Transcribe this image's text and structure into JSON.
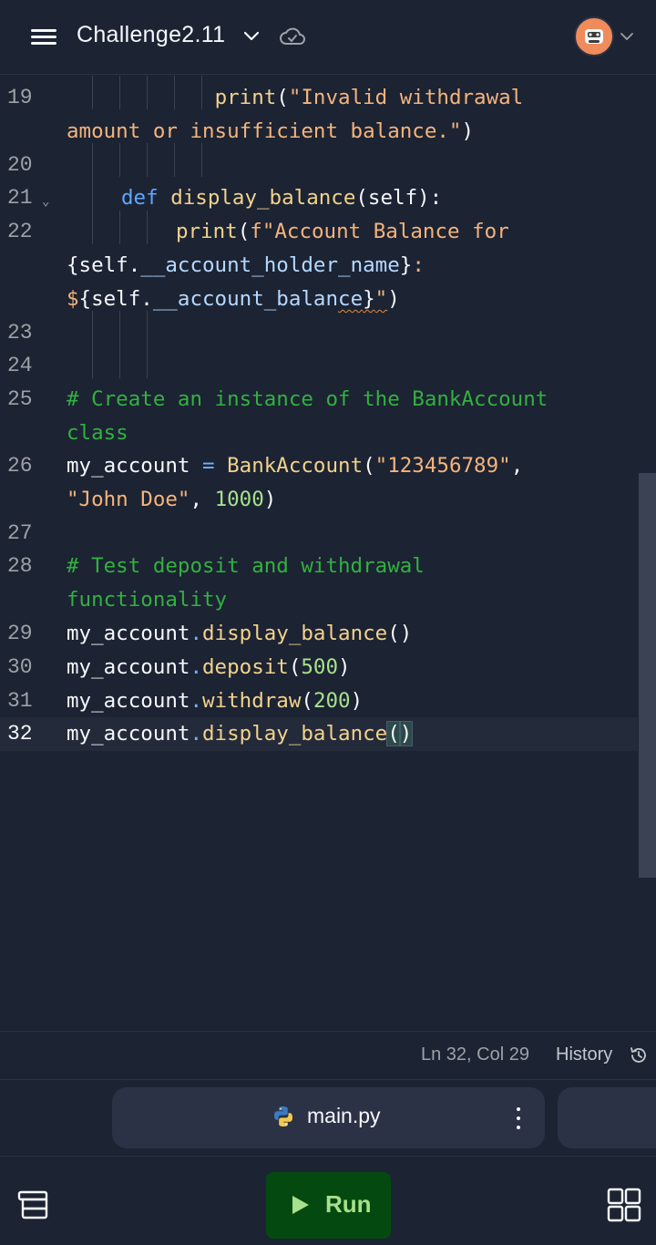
{
  "header": {
    "title": "Challenge2.11"
  },
  "editor": {
    "line_numbers": [
      "19",
      "20",
      "21",
      "22",
      "23",
      "24",
      "25",
      "26",
      "27",
      "28",
      "29",
      "30",
      "31",
      "32"
    ],
    "lines": {
      "l19a_indent": "            ",
      "l19a_print": "print",
      "l19a_paren": "(",
      "l19a_str": "\"Invalid withdrawal",
      "l19b_str": "amount or insufficient balance.\"",
      "l19b_paren": ")",
      "l21_def": "def",
      "l21_fn": "display_balance",
      "l21_rest": "(self):",
      "l22a_print": "print",
      "l22a_paren": "(",
      "l22a_str": "f\"Account Balance for",
      "l22b_open": "{",
      "l22b_self": "self.",
      "l22b_attr": "__account_holder_name",
      "l22b_close": "}",
      "l22b_colon": ":",
      "l22c_dollar": "$",
      "l22c_open": "{",
      "l22c_self": "self.",
      "l22c_attr1": "__account_balan",
      "l22c_attr2": "ce",
      "l22c_close": "}",
      "l22c_quote": "\"",
      "l22c_paren": ")",
      "l25a_cmt": "# Create an instance of the BankAccount",
      "l25b_cmt": "class",
      "l26a_var": "my_account",
      "l26a_eq": " = ",
      "l26a_cls": "BankAccount",
      "l26a_paren": "(",
      "l26a_str": "\"123456789\"",
      "l26a_comma": ",",
      "l26b_str": "\"John Doe\"",
      "l26b_comma": ", ",
      "l26b_num": "1000",
      "l26b_paren": ")",
      "l28a_cmt": "# Test deposit and withdrawal",
      "l28b_cmt": "functionality",
      "l29_var": "my_account",
      "l29_dot": ".",
      "l29_fn": "display_balance",
      "l29_paren": "()",
      "l30_var": "my_account",
      "l30_dot": ".",
      "l30_fn": "deposit",
      "l30_open": "(",
      "l30_num": "500",
      "l30_close": ")",
      "l31_var": "my_account",
      "l31_dot": ".",
      "l31_fn": "withdraw",
      "l31_open": "(",
      "l31_num": "200",
      "l31_close": ")",
      "l32_var": "my_account",
      "l32_dot": ".",
      "l32_fn": "display_balance",
      "l32_open": "(",
      "l32_close": ")"
    }
  },
  "status": {
    "cursor_position": "Ln 32, Col 29",
    "history_label": "History"
  },
  "file_tab": {
    "name": "main.py"
  },
  "toolbar": {
    "run_label": "Run"
  },
  "colors": {
    "background": "#1c2333",
    "run_button": "#044a10",
    "run_text": "#a8e08c",
    "comment": "#32b13f",
    "string": "#f4b47b",
    "keyword": "#5ea8ff"
  },
  "icons": [
    "menu-icon",
    "chevron-down-icon",
    "cloud-saved-icon",
    "avatar",
    "history-icon",
    "python-icon",
    "more-vertical-icon",
    "database-icon",
    "play-icon",
    "grid-icon"
  ]
}
